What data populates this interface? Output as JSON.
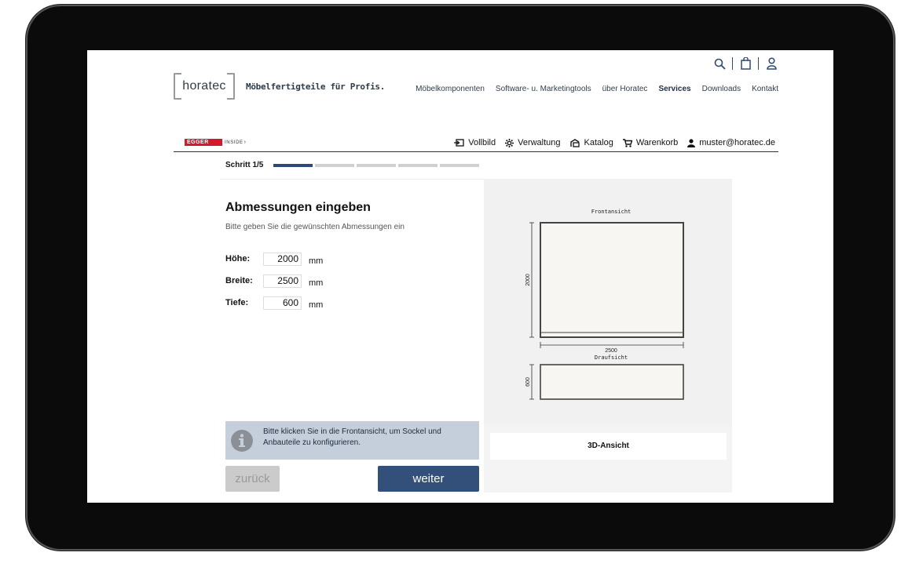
{
  "header": {
    "brand": "horatec",
    "tagline": "Möbelfertigteile für Profis.",
    "nav": [
      {
        "label": "Möbelkomponenten",
        "active": false
      },
      {
        "label": "Software- u. Marketingtools",
        "active": false
      },
      {
        "label": "über Horatec",
        "active": false
      },
      {
        "label": "Services",
        "active": true
      },
      {
        "label": "Downloads",
        "active": false
      },
      {
        "label": "Kontakt",
        "active": false
      }
    ],
    "icons": [
      "search-icon",
      "shopping-bag-icon",
      "user-icon"
    ]
  },
  "appbar": {
    "partner": "EGGER",
    "partner_suffix": "INSIDE",
    "tools": {
      "fullscreen": "Vollbild",
      "admin": "Verwaltung",
      "catalog": "Katalog",
      "cart": "Warenkorb",
      "user": "muster@horatec.de"
    }
  },
  "step": {
    "label": "Schritt 1/5",
    "current": 1,
    "total": 5
  },
  "form": {
    "title": "Abmessungen eingeben",
    "subtitle": "Bitte geben Sie die gewünschten Abmessungen ein",
    "height_label": "Höhe:",
    "height_value": "2000",
    "width_label": "Breite:",
    "width_value": "2500",
    "depth_label": "Tiefe:",
    "depth_value": "600",
    "unit": "mm",
    "info_text": "Bitte klicken Sie in die Frontansicht, um Sockel und Anbauteile zu konfigurieren.",
    "back_label": "zurück",
    "next_label": "weiter"
  },
  "preview": {
    "front_label": "Frontansicht",
    "top_label": "Draufsicht",
    "dim_height": "2000",
    "dim_width": "2500",
    "dim_depth": "600",
    "view3d_label": "3D-Ansicht"
  },
  "colors": {
    "primary": "#33507a",
    "progress_done": "#2b4a76",
    "info_bg": "#c5cfdc",
    "egger_red": "#d3192c"
  }
}
